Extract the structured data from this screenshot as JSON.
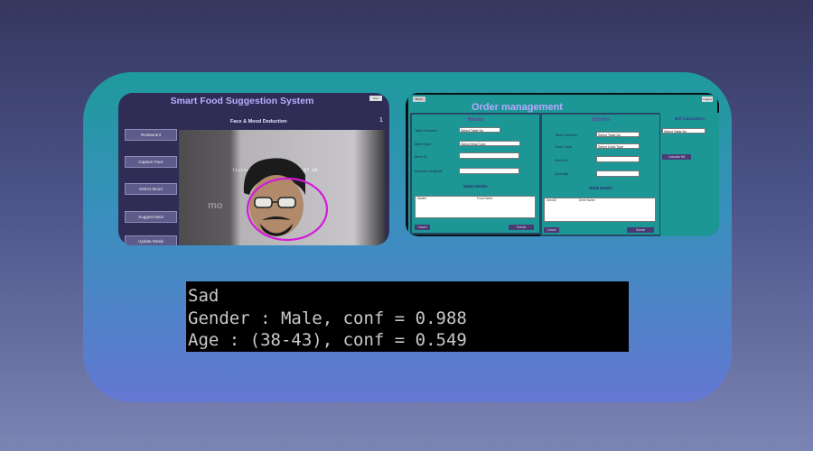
{
  "colors": {
    "card_top": "#1e9a9c",
    "card_bottom": "#6477d2",
    "terminal_bg": "#000000",
    "terminal_text": "#c8c8c8"
  },
  "food_app": {
    "title": "Smart Food Suggestion System",
    "exit_label": "Exit",
    "subtitle": "Face & Mood Deduction",
    "counter": "1",
    "buttons": [
      "Restaurant",
      "Capture Face",
      "Detect Mood",
      "Suggest Meal",
      "Update Meals"
    ],
    "camera_label": "living Detection: face = 87.68",
    "watermark": "mo"
  },
  "order_app": {
    "back_label": "BACK",
    "logout_label": "Logout",
    "title": "Order management",
    "meals": {
      "heading": "Meals",
      "table_number_label": "Table Number",
      "table_select": "Select Table No",
      "meal_type_label": "Meal Type",
      "meal_type_select": "Select Meal Type",
      "meal_id_label": "Meal ID",
      "number_label": "Number of Meals",
      "details_heading": "Meals Details",
      "columns": [
        "MealId",
        "Food Name"
      ],
      "cancel_label": "Cancel",
      "submit_label": "Submit"
    },
    "drinks": {
      "heading": "Drinks",
      "table_number_label": "Table Number",
      "table_select": "Select Table No",
      "drink_type_label": "Drink Type",
      "drink_type_select": "Select Drink Type",
      "drink_id_label": "Drink ID",
      "quantity_label": "Quantity",
      "details_heading": "Drink Details",
      "columns": [
        "DrinkID",
        "Drink Name"
      ],
      "cancel_label": "Cancel",
      "submit_label": "Submit"
    },
    "bill": {
      "heading": "Bill Calculation",
      "table_select": "Select Table No",
      "calc_label": "Calculate Bill"
    }
  },
  "terminal": {
    "line1": "Sad",
    "line2": "Gender : Male, conf = 0.988",
    "line3": "Age : (38-43), conf = 0.549"
  }
}
